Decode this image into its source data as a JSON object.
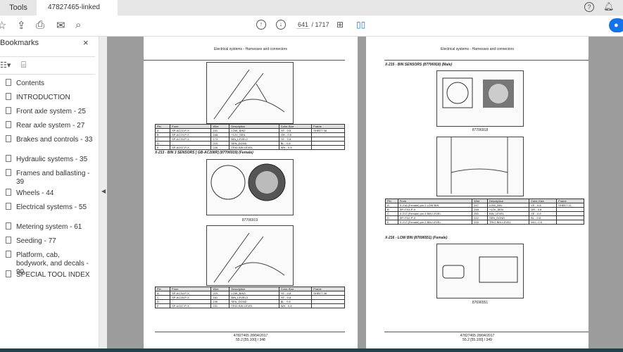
{
  "tabs": {
    "tools": "Tools",
    "document": "47827465-linked pd...",
    "close": "×"
  },
  "toolbar": {
    "icons": [
      "star-icon",
      "cloud-upload-icon",
      "print-icon",
      "mail-icon",
      "zoom-icon"
    ],
    "page_current": "641",
    "page_total": "/ 1717",
    "share_icon": "user-icon"
  },
  "sidebar": {
    "title": "Bookmarks",
    "close": "×",
    "items": [
      {
        "label": "Contents"
      },
      {
        "label": "INTRODUCTION"
      },
      {
        "label": "Front axle system - 25"
      },
      {
        "label": "Rear axle system - 27"
      },
      {
        "label": "Brakes and controls - 33"
      },
      {
        "label": "Hydraulic systems - 35"
      },
      {
        "label": "Frames and ballasting - 39"
      },
      {
        "label": "Wheels - 44"
      },
      {
        "label": "Electrical systems - 55"
      },
      {
        "label": "Metering system - 61"
      },
      {
        "label": "Seeding - 77"
      },
      {
        "label": "Platform, cab, bodywork, and decals - 90"
      },
      {
        "label": "SPECIAL TOOL INDEX"
      }
    ]
  },
  "left_page": {
    "header": "Electrical systems - Harnesses and connectors",
    "table_headers": [
      "Pin",
      "From",
      "Wire",
      "Description",
      "Color-Size",
      "Frame"
    ],
    "table1": [
      [
        "A",
        "SP-AC22-P-X",
        "161",
        "LOW_BIN2",
        "YE - 0.8",
        "SHEET 08"
      ],
      [
        "B",
        "SP-AC19-P-X",
        "168",
        "+12V_SEN",
        "OR - 0.8",
        ""
      ],
      [
        "C",
        "SP-AC33-P-X",
        "173",
        "BIN_LEVEL2",
        "YE - 0.8",
        ""
      ],
      [
        "D",
        "",
        "215",
        "SEN_DGND",
        "BL - 0.8",
        ""
      ],
      [
        "E",
        "SP-AC57-P-X",
        "226",
        "TRIG BIN LEVEL",
        "WH - 0.5",
        ""
      ]
    ],
    "caption": "X-213 - BIN 3 SENSORS [ GB-AC208R] (87706919) (Female)",
    "part": "87706919",
    "table2": [
      [
        "A",
        "SP-AC34-P-X",
        "219",
        "LOW_BIN3",
        "YE - 0.8",
        "SHEET 08"
      ],
      [
        "C",
        "SP-AC28-P-X",
        "181",
        "BIN_LEVEL3",
        "YE - 0.8",
        ""
      ],
      [
        "D",
        "",
        "196",
        "SEN_DGND",
        "BL - 0.8",
        ""
      ],
      [
        "E",
        "SP-AC67-P-X",
        "231",
        "TRIG BIN LEVEL",
        "WH - 0.8",
        ""
      ]
    ],
    "footer1": "47827465 28/04/2017",
    "footer2": "55.2 [55.100] / 348"
  },
  "right_page": {
    "header": "Electrical systems - Harnesses and connectors",
    "caption1": "X-215 - BIN SENSORS (87706918) (Male)",
    "part1": "87706918",
    "table": [
      [
        "A",
        "X-216 (Female) pin 2 LOW BIN",
        "247",
        "LOW_BIN",
        "YE - 0.8",
        "SHEET 11"
      ],
      [
        "B",
        "SP-IT01-P-X",
        "248",
        "+12V_SEN",
        "OR - 0.8",
        ""
      ],
      [
        "C",
        "X-217 (Female) pin 4 BIN LEVEL",
        "250",
        "BIN_LEVEL",
        "YE - 0.8",
        ""
      ],
      [
        "D",
        "SP-IT02-P-X",
        "242",
        "SEN_DGND",
        "BL - 0.8",
        ""
      ],
      [
        "E",
        "X-217 (Female) pin 2 BIN LEVEL",
        "255",
        "TRIG BIN LEVEL",
        "WH - 0.5",
        ""
      ]
    ],
    "caption2": "X-216 - LOW BIN (87696551) (Female)",
    "part2": "87696551",
    "footer1": "47827465 28/04/2017",
    "footer2": "55.2 [55.100] / 349"
  },
  "colors": {
    "accent": "#1473e6",
    "doc_bg": "#9c9c9c"
  }
}
